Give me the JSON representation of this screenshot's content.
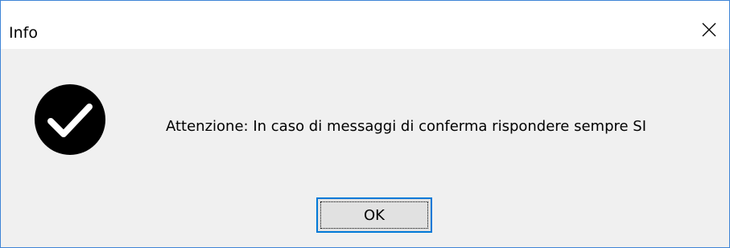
{
  "window": {
    "title": "Info",
    "close_icon": "close-icon"
  },
  "dialog": {
    "icon": "check-circle-icon",
    "message": "Attenzione: In caso di messaggi di conferma rispondere sempre SI",
    "ok_label": "OK"
  },
  "colors": {
    "window_border": "#3e84d6",
    "titlebar_bg": "#ffffff",
    "content_bg": "#f0f0f0",
    "button_border": "#0078d7",
    "button_bg": "#e1e1e1",
    "icon_fill": "#000000"
  }
}
